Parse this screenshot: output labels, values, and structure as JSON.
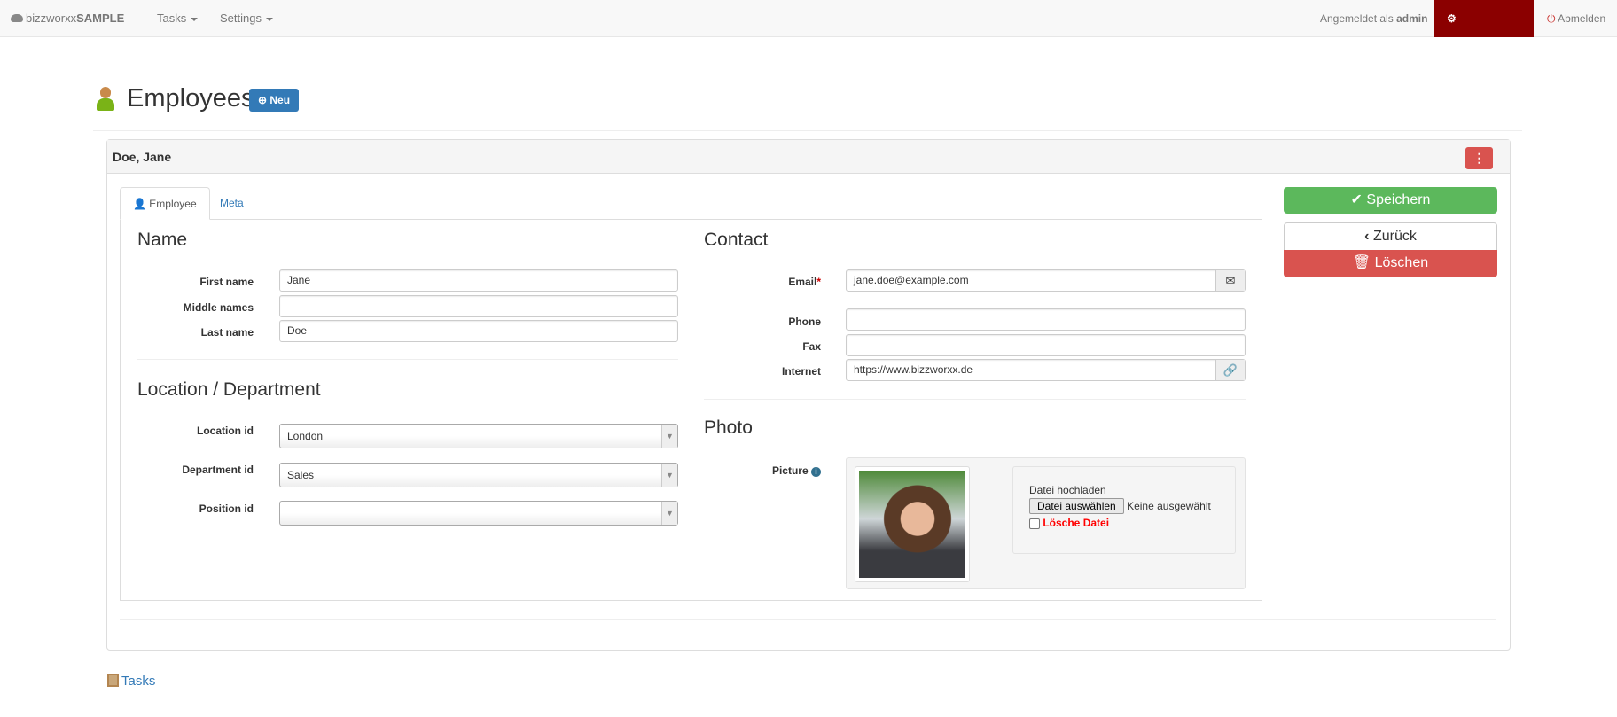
{
  "navbar": {
    "brand_light": "bizzworxx",
    "brand_bold": "SAMPLE",
    "menu": [
      {
        "label": "Tasks"
      },
      {
        "label": "Settings"
      }
    ],
    "logged_in_prefix": "Angemeldet als",
    "user": "admin",
    "admin_label": "Adminbereich",
    "logout_label": "Abmelden",
    "admin_color": "#8b0000"
  },
  "page": {
    "title": "Employees",
    "new_label": "Neu"
  },
  "record": {
    "title": "Doe, Jane"
  },
  "tabs": [
    {
      "label": "Employee",
      "active": true
    },
    {
      "label": "Meta",
      "active": false
    }
  ],
  "name_section": {
    "heading": "Name",
    "fields": [
      {
        "label": "First name",
        "value": "Jane"
      },
      {
        "label": "Middle names",
        "value": ""
      },
      {
        "label": "Last name",
        "value": "Doe"
      }
    ]
  },
  "location_section": {
    "heading": "Location / Department",
    "fields": [
      {
        "label": "Location id",
        "value": "London"
      },
      {
        "label": "Department id",
        "value": "Sales"
      },
      {
        "label": "Position id",
        "value": ""
      }
    ]
  },
  "contact_section": {
    "heading": "Contact",
    "email_label": "Email",
    "required_mark": "*",
    "email": "jane.doe@example.com",
    "phone_label": "Phone",
    "phone": "",
    "fax_label": "Fax",
    "fax": "",
    "internet_label": "Internet",
    "internet": "https://www.bizzworxx.de"
  },
  "photo_section": {
    "heading": "Photo",
    "picture_label": "Picture",
    "upload_label": "Datei hochladen",
    "choose_button": "Datei auswählen",
    "no_file": "Keine ausgewählt",
    "delete_label": "Lösche Datei"
  },
  "actions": {
    "save": "Speichern",
    "back": "Zurück",
    "delete": "Löschen"
  },
  "footer": {
    "tasks_link": "Tasks"
  }
}
